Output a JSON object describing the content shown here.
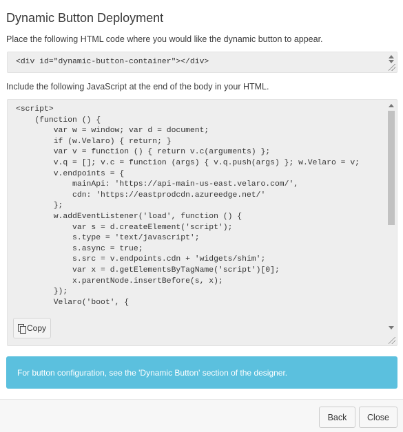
{
  "dialog": {
    "title": "Dynamic Button Deployment",
    "html_instruction": "Place the following HTML code where you would like the dynamic button to appear.",
    "html_snippet": "<div id=\"dynamic-button-container\"></div>",
    "js_instruction": "Include the following JavaScript at the end of the body in your HTML.",
    "js_snippet": "<script>\n    (function () {\n        var w = window; var d = document;\n        if (w.Velaro) { return; }\n        var v = function () { return v.c(arguments) };\n        v.q = []; v.c = function (args) { v.q.push(args) }; w.Velaro = v;\n        v.endpoints = {\n            mainApi: 'https://api-main-us-east.velaro.com/',\n            cdn: 'https://eastprodcdn.azureedge.net/'\n        };\n        w.addEventListener('load', function () {\n            var s = d.createElement('script');\n            s.type = 'text/javascript';\n            s.async = true;\n            s.src = v.endpoints.cdn + 'widgets/shim';\n            var x = d.getElementsByTagName('script')[0];\n            x.parentNode.insertBefore(s, x);\n        });\n        Velaro('boot', {",
    "copy_label": "Copy",
    "info_text": "For button configuration, see the 'Dynamic Button' section of the designer.",
    "back_label": "Back",
    "close_label": "Close"
  },
  "colors": {
    "info_bg": "#5bc0de",
    "code_bg": "#eeeeee"
  }
}
